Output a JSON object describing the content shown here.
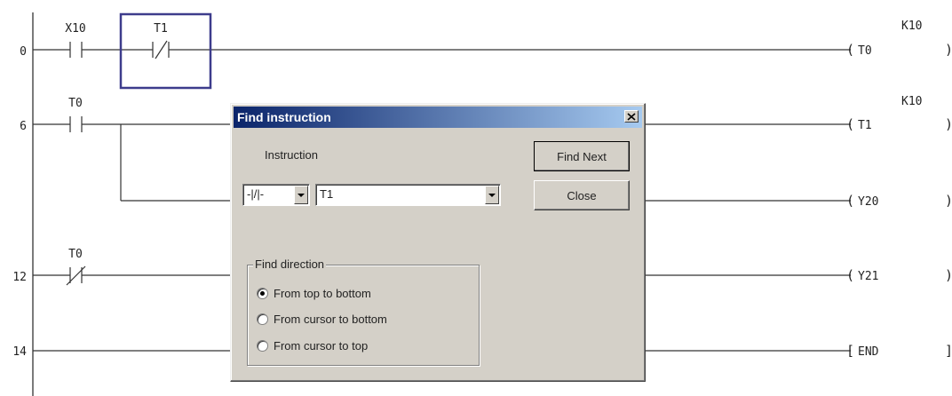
{
  "ladder": {
    "step_numbers": [
      "0",
      "6",
      "12",
      "14"
    ],
    "contacts": [
      {
        "label": "X10",
        "type": "no"
      },
      {
        "label": "T1",
        "type": "nc"
      },
      {
        "label": "T0",
        "type": "no"
      },
      {
        "label": "T0",
        "type": "nc"
      }
    ],
    "coils": [
      {
        "label": "T0",
        "constant": "K10"
      },
      {
        "label": "T1",
        "constant": "K10"
      },
      {
        "label": "Y20",
        "constant": ""
      },
      {
        "label": "Y21",
        "constant": ""
      },
      {
        "label": "END",
        "constant": ""
      }
    ],
    "cursor_color": "#3d3c8c"
  },
  "dialog": {
    "title": "Find instruction",
    "instruction_label": "Instruction",
    "type_combo_value": "-|/|-",
    "device_combo_value": "T1",
    "find_next_label": "Find Next",
    "close_label": "Close",
    "direction_group_label": "Find direction",
    "directions": [
      {
        "label": "From top to bottom",
        "selected": true
      },
      {
        "label": "From cursor to bottom",
        "selected": false
      },
      {
        "label": "From cursor to top",
        "selected": false
      }
    ]
  }
}
